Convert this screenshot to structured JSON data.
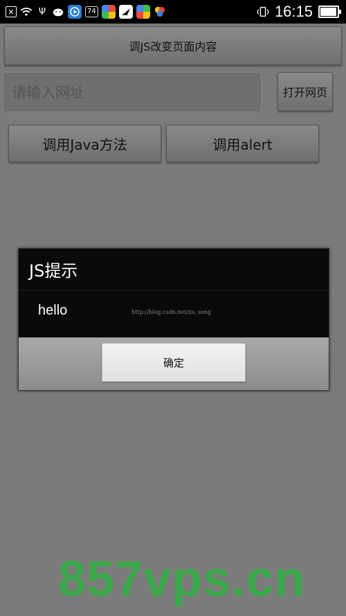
{
  "status_bar": {
    "time": "16:15",
    "badge": "74",
    "battery_level": 0.95,
    "icons": [
      "close-box-icon",
      "wifi-icon",
      "usb-icon",
      "android-icon",
      "play-icon",
      "badge-icon",
      "app-green-icon",
      "app-bird-icon",
      "app-green2-icon",
      "app-multi-icon",
      "vibrate-icon",
      "battery-icon"
    ]
  },
  "toolbar": {
    "change_page_label": "调JS改变页面内容",
    "open_page_label": "打开网页",
    "call_java_label": "调用Java方法",
    "call_alert_label": "调用alert"
  },
  "url_input": {
    "placeholder": "请输入网址"
  },
  "dialog": {
    "title": "JS提示",
    "message": "hello",
    "watermark": "http://blog.csdn.net/xu_song",
    "ok_label": "确定"
  },
  "watermark": {
    "text": "857vps.cn"
  },
  "colors": {
    "watermark": "#3aa84a",
    "background": "#7a7a7a",
    "dialog": "#0a0a0a"
  }
}
